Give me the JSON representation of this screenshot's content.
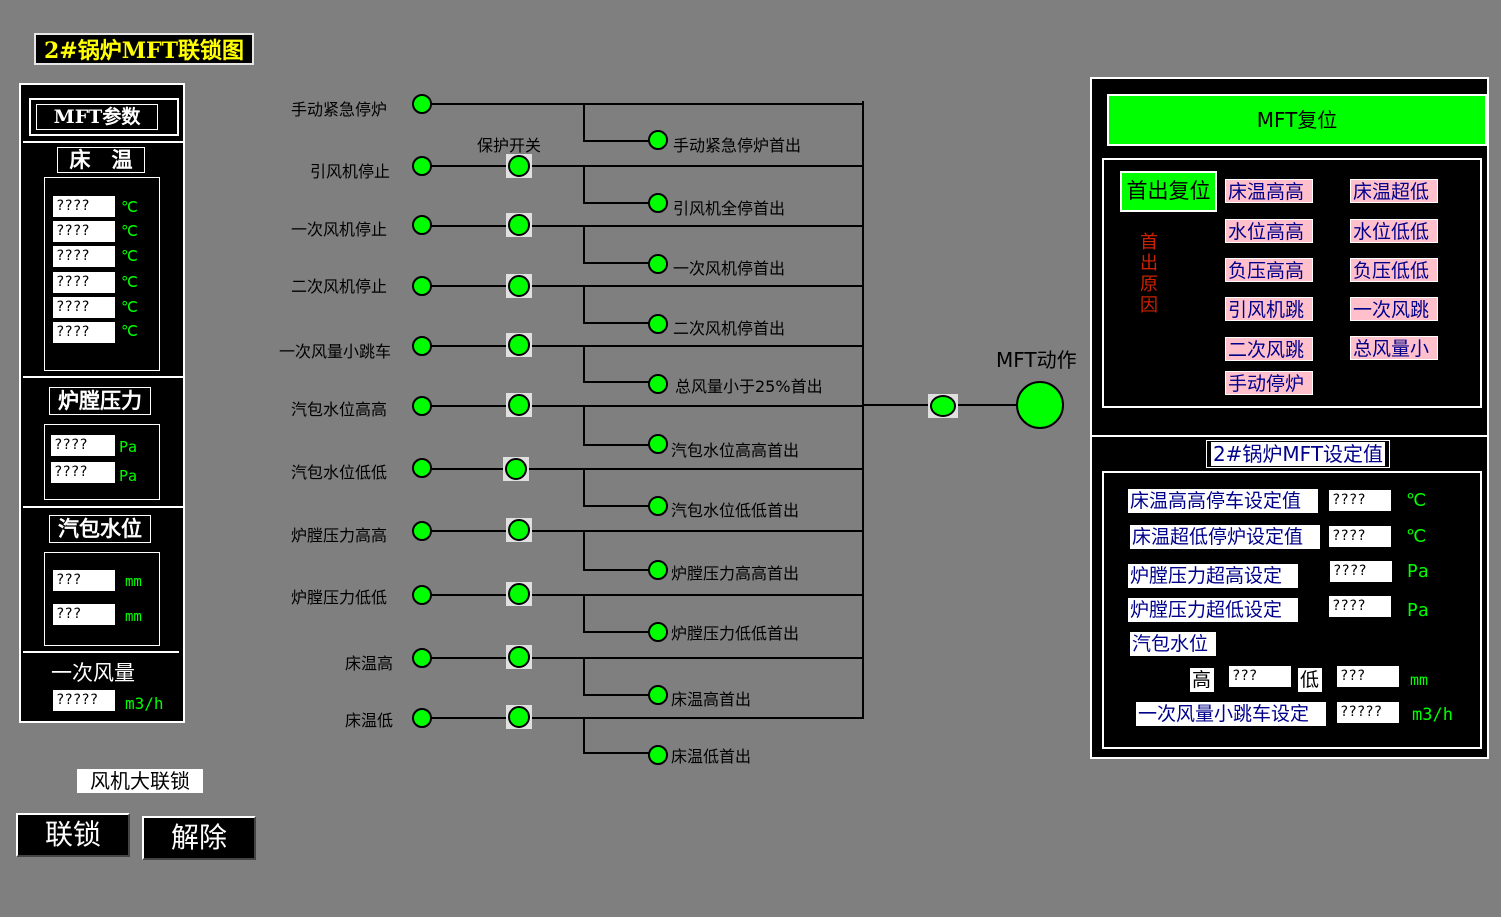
{
  "title": "2#锅炉MFT联锁图",
  "left_panel": {
    "header": "MFT参数",
    "bed_temp": {
      "title": "床　温",
      "values": [
        "????",
        "????",
        "????",
        "????",
        "????",
        "????"
      ],
      "unit": "℃"
    },
    "furnace_pressure": {
      "title": "炉膛压力",
      "values": [
        "????",
        "????"
      ],
      "unit": "Pa"
    },
    "drum_level": {
      "title": "汽包水位",
      "values": [
        "???",
        "???"
      ],
      "unit": "mm"
    },
    "primary_air": {
      "title": "一次风量",
      "value": "?????",
      "unit": "m3/h"
    }
  },
  "fan_interlock": {
    "label": "风机大联锁",
    "lock_button": "联锁",
    "release_button": "解除"
  },
  "diagram": {
    "protect_switch_label": "保护开关",
    "trip_inputs": [
      "手动紧急停炉",
      "引风机停止",
      "一次风机停止",
      "二次风机停止",
      "一次风量小跳车",
      "汽包水位高高",
      "汽包水位低低",
      "炉膛压力高高",
      "炉膛压力低低",
      "床温高",
      "床温低"
    ],
    "first_out": [
      "手动紧急停炉首出",
      "引风机全停首出",
      "一次风机停首出",
      "二次风机停首出",
      "总风量小于25%首出",
      "汽包水位高高首出",
      "汽包水位低低首出",
      "炉膛压力高高首出",
      "炉膛压力低低首出",
      "床温高首出",
      "床温低首出"
    ],
    "mft_action_label": "MFT动作"
  },
  "right_panel": {
    "mft_reset_button": "MFT复位",
    "first_reset_button": "首出复位",
    "first_cause_label": "首出原因",
    "causes_left": [
      "床温高高",
      "水位高高",
      "负压高高",
      "引风机跳",
      "二次风跳",
      "手动停炉"
    ],
    "causes_right": [
      "床温超低",
      "水位低低",
      "负压低低",
      "一次风跳",
      "总风量小"
    ],
    "setpoints_title": "2#锅炉MFT设定值",
    "setpoints": {
      "bed_high": {
        "label": "床温高高停车设定值",
        "value": "????",
        "unit": "℃"
      },
      "bed_low": {
        "label": "床温超低停炉设定值",
        "value": "????",
        "unit": "℃"
      },
      "press_high": {
        "label": "炉膛压力超高设定",
        "value": "????",
        "unit": "Pa"
      },
      "press_low": {
        "label": "炉膛压力超低设定",
        "value": "????",
        "unit": "Pa"
      },
      "drum_label": "汽包水位",
      "drum_high_label": "高",
      "drum_high_value": "???",
      "drum_low_label": "低",
      "drum_low_value": "???",
      "drum_unit": "mm",
      "primary_air_trip": {
        "label": "一次风量小跳车设定",
        "value": "?????",
        "unit": "m3/h"
      }
    }
  },
  "colors": {
    "background": "#7f7f7f",
    "led_on": "#00ff00",
    "title_text": "#ffff00",
    "pink": "#ffc0cb"
  }
}
